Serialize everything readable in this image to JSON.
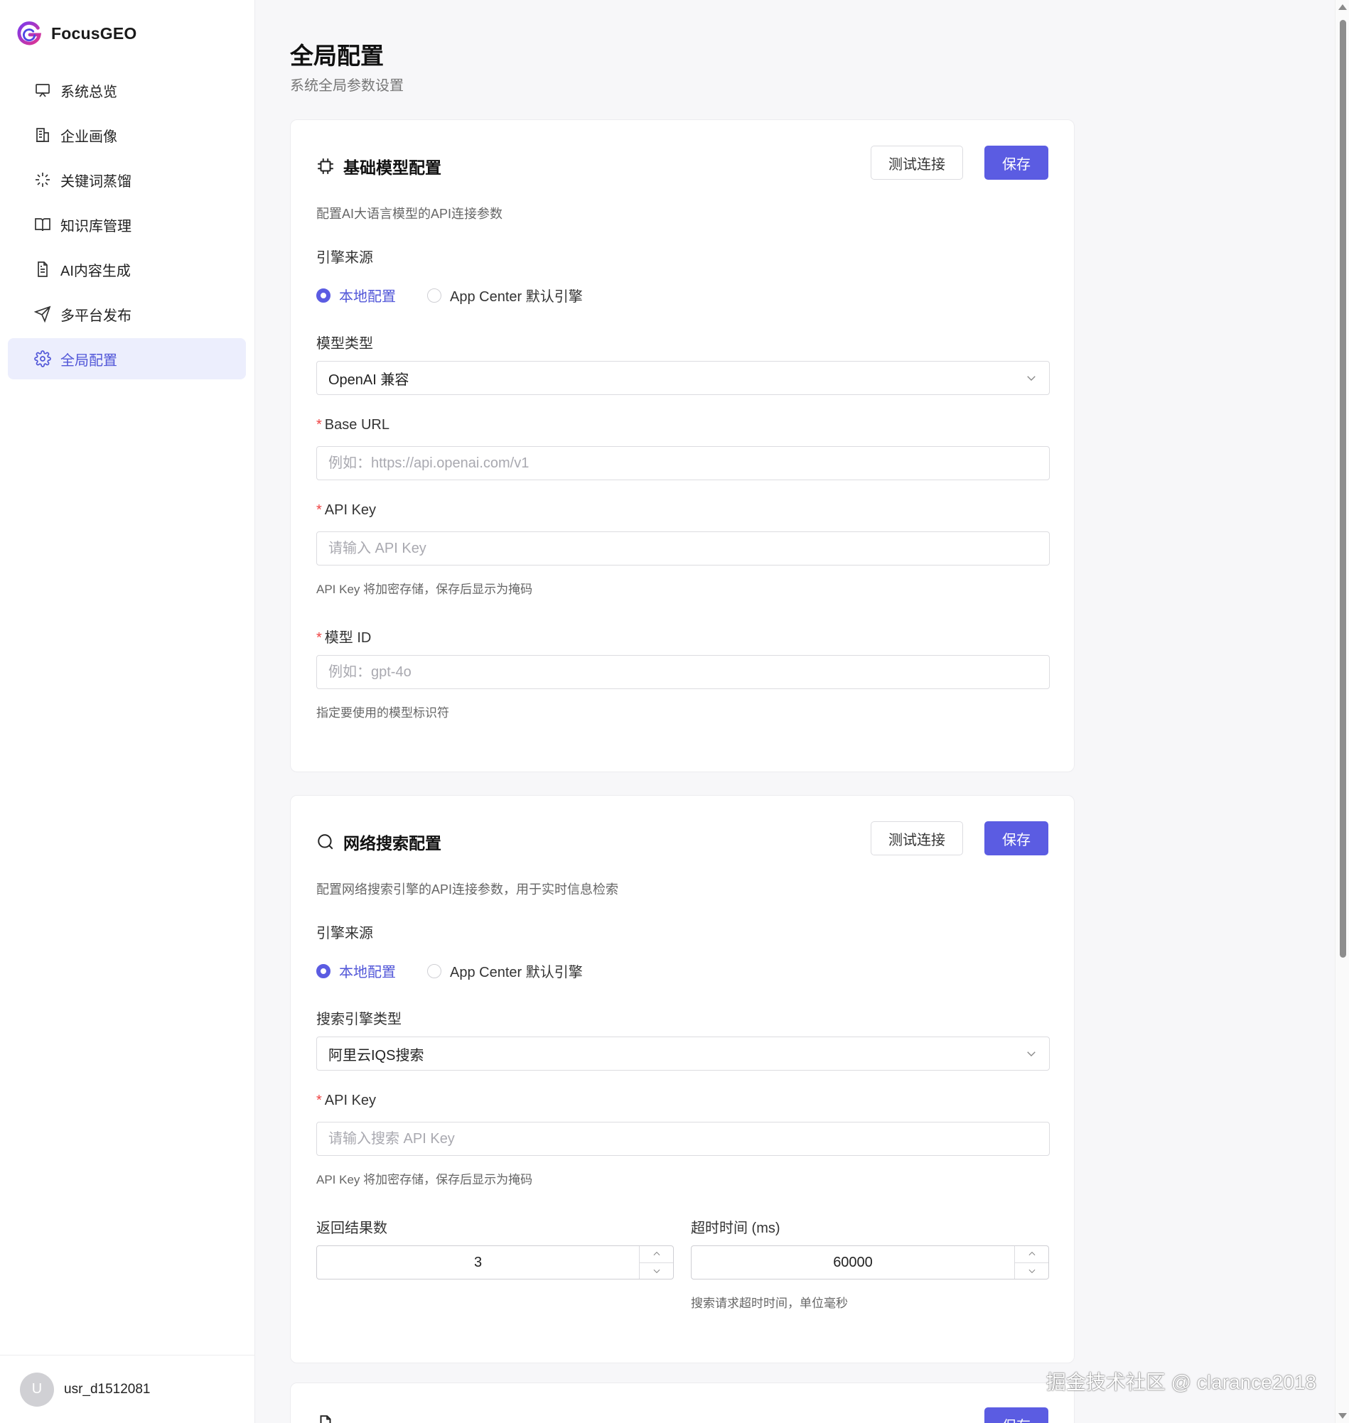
{
  "brand": {
    "name": "FocusGEO"
  },
  "nav": [
    {
      "label": "系统总览",
      "icon": "monitor-icon"
    },
    {
      "label": "企业画像",
      "icon": "building-icon"
    },
    {
      "label": "关键词蒸馏",
      "icon": "sparkle-icon"
    },
    {
      "label": "知识库管理",
      "icon": "book-icon"
    },
    {
      "label": "AI内容生成",
      "icon": "document-icon"
    },
    {
      "label": "多平台发布",
      "icon": "send-icon"
    },
    {
      "label": "全局配置",
      "icon": "gear-icon",
      "active": true
    }
  ],
  "user": {
    "avatar": "U",
    "name": "usr_d1512081"
  },
  "page": {
    "title": "全局配置",
    "subtitle": "系统全局参数设置"
  },
  "model_card": {
    "title": "基础模型配置",
    "test_label": "测试连接",
    "save_label": "保存",
    "description": "配置AI大语言模型的API连接参数",
    "engine_label": "引擎来源",
    "engine_options": [
      "本地配置",
      "App Center 默认引擎"
    ],
    "engine_selected": "本地配置",
    "type_label": "模型类型",
    "type_value": "OpenAI 兼容",
    "base_url_label": "Base URL",
    "base_url_placeholder": "例如：https://api.openai.com/v1",
    "api_key_label": "API Key",
    "api_key_placeholder": "请输入 API Key",
    "api_key_hint": "API Key 将加密存储，保存后显示为掩码",
    "model_id_label": "模型 ID",
    "model_id_placeholder": "例如：gpt-4o",
    "model_id_hint": "指定要使用的模型标识符"
  },
  "search_card": {
    "title": "网络搜索配置",
    "test_label": "测试连接",
    "save_label": "保存",
    "description": "配置网络搜索引擎的API连接参数，用于实时信息检索",
    "engine_label": "引擎来源",
    "engine_options": [
      "本地配置",
      "App Center 默认引擎"
    ],
    "engine_selected": "本地配置",
    "type_label": "搜索引擎类型",
    "type_value": "阿里云IQS搜索",
    "api_key_label": "API Key",
    "api_key_placeholder": "请输入搜索 API Key",
    "api_key_hint": "API Key 将加密存储，保存后显示为掩码",
    "result_count_label": "返回结果数",
    "result_count_value": "3",
    "timeout_label": "超时时间 (ms)",
    "timeout_value": "60000",
    "timeout_hint": "搜索请求超时时间，单位毫秒"
  },
  "third_card": {
    "save_label": "保存"
  },
  "watermark": "掘金技术社区 @ clarance2018",
  "colors": {
    "accent": "#5b5ce2",
    "active_bg": "#eceefd",
    "required": "#ef4444"
  }
}
